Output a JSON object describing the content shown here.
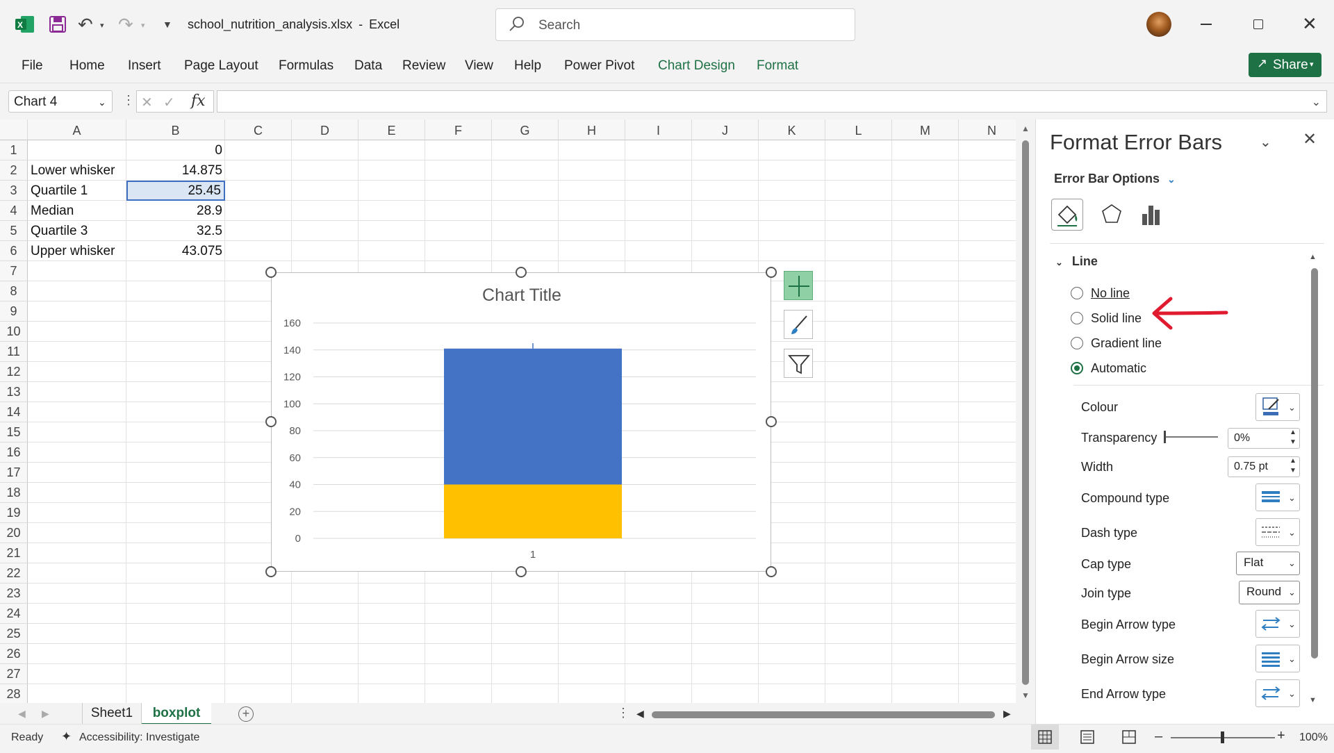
{
  "window": {
    "filename": "school_nutrition_analysis.xlsx",
    "separator": "-",
    "app": "Excel",
    "search_placeholder": "Search",
    "share_label": "Share"
  },
  "ribbon": {
    "tabs": [
      "File",
      "Home",
      "Insert",
      "Page Layout",
      "Formulas",
      "Data",
      "Review",
      "View",
      "Help",
      "Power Pivot",
      "Chart Design",
      "Format"
    ]
  },
  "formula_bar": {
    "name_box": "Chart 4",
    "formula": ""
  },
  "sheet": {
    "columns": [
      "A",
      "B",
      "C",
      "D",
      "E",
      "F",
      "G",
      "H",
      "I",
      "J",
      "K",
      "L",
      "M",
      "N"
    ],
    "rows": [
      "1",
      "2",
      "3",
      "4",
      "5",
      "6",
      "7",
      "8",
      "9",
      "10",
      "11",
      "12",
      "13",
      "14",
      "15",
      "16",
      "17",
      "18",
      "19",
      "20",
      "21",
      "22",
      "23",
      "24",
      "25",
      "26",
      "27",
      "28"
    ],
    "cells": [
      {
        "label": "",
        "value": "0"
      },
      {
        "label": "Lower whisker",
        "value": "14.875"
      },
      {
        "label": "Quartile 1",
        "value": "25.45"
      },
      {
        "label": "Median",
        "value": "28.9"
      },
      {
        "label": "Quartile 3",
        "value": "32.5"
      },
      {
        "label": "Upper whisker",
        "value": "43.075"
      }
    ],
    "tabs": [
      "Sheet1",
      "boxplot"
    ],
    "active_tab": "boxplot"
  },
  "chart_data": {
    "type": "bar",
    "title": "Chart Title",
    "categories": [
      "1"
    ],
    "series": [
      {
        "values": [
          40
        ],
        "color": "#ffc000"
      },
      {
        "values": [
          101
        ],
        "color": "#4472c4"
      }
    ],
    "error_bar_top": 145,
    "ylim": [
      0,
      160
    ],
    "yticks": [
      "0",
      "20",
      "40",
      "60",
      "80",
      "100",
      "120",
      "140",
      "160"
    ],
    "grid": true
  },
  "panel": {
    "title": "Format Error Bars",
    "options_label": "Error Bar Options",
    "section": "Line",
    "radios": [
      {
        "label": "No line",
        "selected": false
      },
      {
        "label": "Solid line",
        "selected": false
      },
      {
        "label": "Gradient line",
        "selected": false
      },
      {
        "label": "Automatic",
        "selected": true
      }
    ],
    "props": {
      "colour": "Colour",
      "transparency": "Transparency",
      "transparency_value": "0%",
      "width": "Width",
      "width_value": "0.75 pt",
      "compound": "Compound type",
      "dash": "Dash type",
      "cap": "Cap type",
      "cap_value": "Flat",
      "join": "Join type",
      "join_value": "Round",
      "begin_arrow_type": "Begin Arrow type",
      "begin_arrow_size": "Begin Arrow size",
      "end_arrow_type": "End Arrow type"
    }
  },
  "status": {
    "ready": "Ready",
    "accessibility": "Accessibility: Investigate",
    "zoom": "100%"
  },
  "colors": {
    "accent_green": "#1e7145",
    "excel_green": "#107c41",
    "annotation_red": "#e01b2f"
  }
}
